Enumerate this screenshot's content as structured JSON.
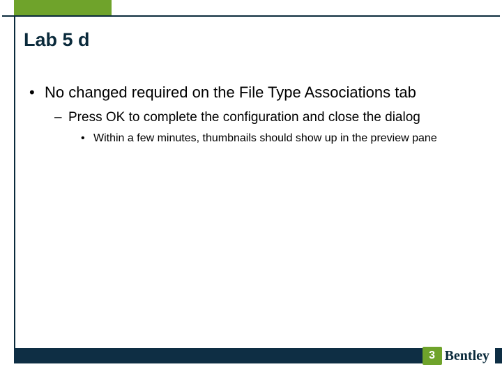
{
  "title": "Lab 5 d",
  "bullets": {
    "b1": "No changed required on the File Type Associations tab",
    "b2": "Press OK to complete the configuration and close the dialog",
    "b3": "Within a few minutes, thumbnails should show up in the preview pane"
  },
  "logo": {
    "mark": "3",
    "text": "Bentley"
  }
}
